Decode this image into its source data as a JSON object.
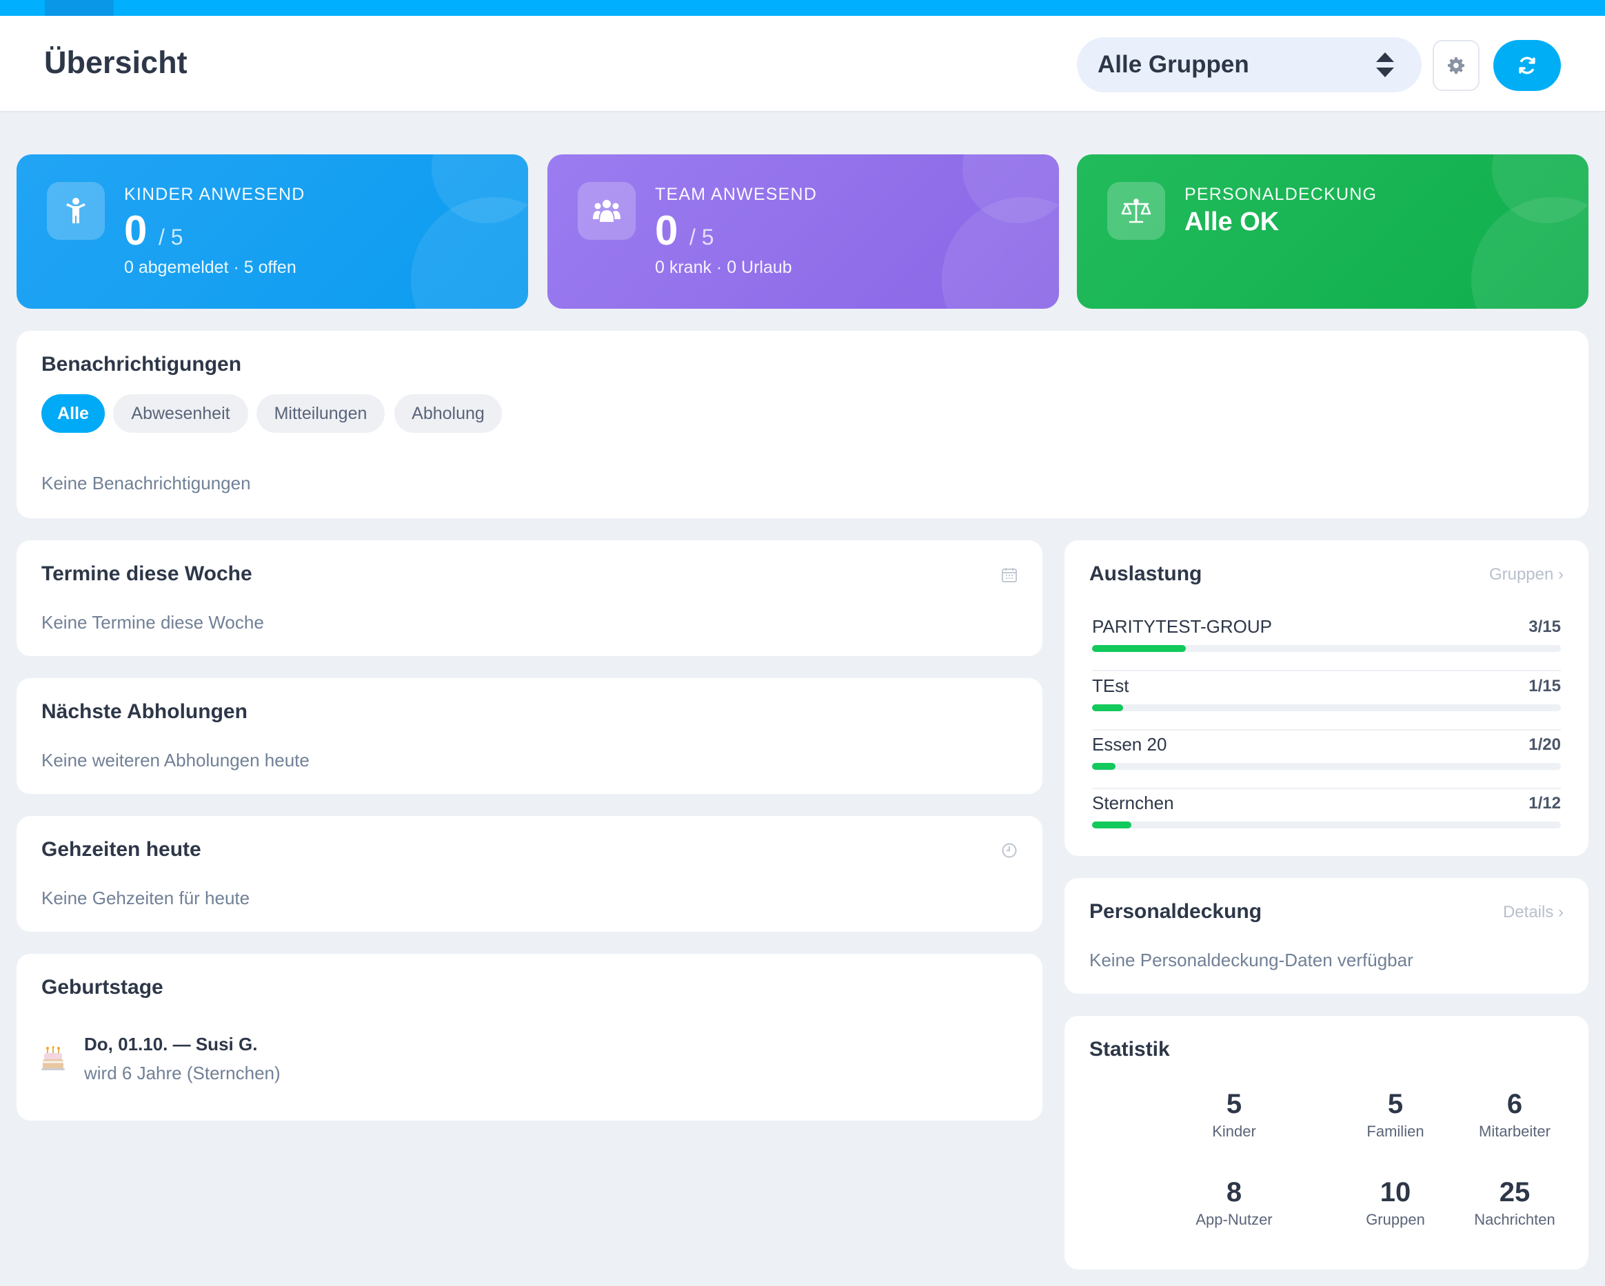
{
  "header": {
    "title": "Übersicht",
    "group_select_value": "Alle Gruppen"
  },
  "cards": {
    "kinder": {
      "label": "KINDER ANWESEND",
      "count": "0",
      "total": "/ 5",
      "sub": "0 abgemeldet · 5 offen",
      "color": "#1aa1f3"
    },
    "team": {
      "label": "TEAM ANWESEND",
      "count": "0",
      "total": "/ 5",
      "sub": "0 krank · 0 Urlaub",
      "color": "#9473ec"
    },
    "personal": {
      "label": "PERSONALDECKUNG",
      "status": "Alle OK",
      "color": "#18b656"
    }
  },
  "notifications": {
    "title": "Benachrichtigungen",
    "filters": [
      "Alle",
      "Abwesenheit",
      "Mitteilungen",
      "Abholung"
    ],
    "active_filter": "Alle",
    "empty": "Keine Benachrichtigungen"
  },
  "termine": {
    "title": "Termine diese Woche",
    "empty": "Keine Termine diese Woche",
    "icon": "calendar-icon"
  },
  "abholungen": {
    "title": "Nächste Abholungen",
    "empty": "Keine weiteren Abholungen heute"
  },
  "gehzeiten": {
    "title": "Gehzeiten heute",
    "empty": "Keine Gehzeiten für heute",
    "icon": "clock-icon"
  },
  "geburtstage": {
    "title": "Geburtstage",
    "items": [
      {
        "headline": "Do, 01.10. — Susi G.",
        "detail": "wird 6 Jahre (Sternchen)",
        "icon": "birthday-cake-icon"
      }
    ]
  },
  "auslastung": {
    "title": "Auslastung",
    "link": "Gruppen ›",
    "bar_color": "#12c95c",
    "groups": [
      {
        "name": "PARITYTEST-GROUP",
        "value": "3/15",
        "current": 3,
        "capacity": 15
      },
      {
        "name": "TEst",
        "value": "1/15",
        "current": 1,
        "capacity": 15
      },
      {
        "name": "Essen 20",
        "value": "1/20",
        "current": 1,
        "capacity": 20
      },
      {
        "name": "Sternchen",
        "value": "1/12",
        "current": 1,
        "capacity": 12
      }
    ]
  },
  "personaldeckung": {
    "title": "Personaldeckung",
    "link": "Details ›",
    "empty": "Keine Personaldeckung-Daten verfügbar"
  },
  "statistik": {
    "title": "Statistik",
    "items": [
      {
        "value": "5",
        "label": "Kinder"
      },
      {
        "value": "5",
        "label": "Familien"
      },
      {
        "value": "6",
        "label": "Mitarbeiter"
      },
      {
        "value": "8",
        "label": "App-Nutzer"
      },
      {
        "value": "10",
        "label": "Gruppen"
      },
      {
        "value": "25",
        "label": "Nachrichten"
      }
    ]
  }
}
